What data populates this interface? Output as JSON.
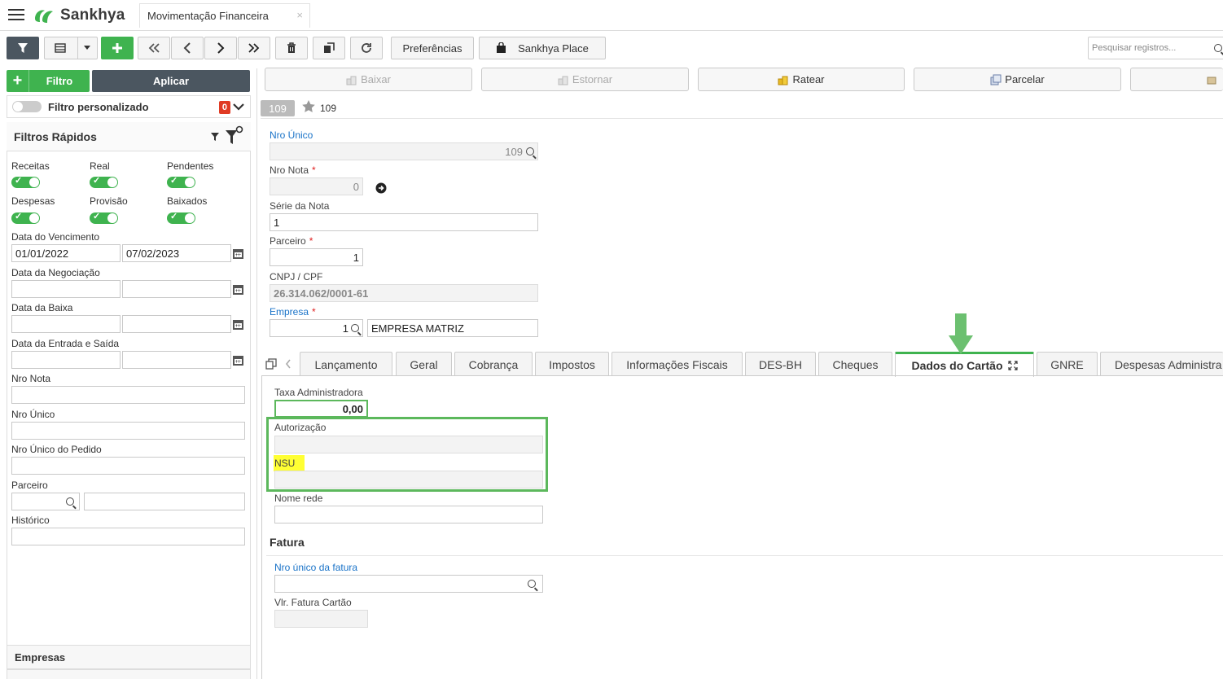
{
  "app": {
    "brand": "Sankhya",
    "tab_title": "Movimentação Financeira",
    "tab_close": "×"
  },
  "toolbar": {
    "preferences_label": "Preferências",
    "place_label": "Sankhya Place",
    "search_placeholder": "Pesquisar registros..."
  },
  "filter_panel": {
    "filter_button": "Filtro",
    "apply_button": "Aplicar",
    "custom_filter_label": "Filtro personalizado",
    "custom_filter_count": "0",
    "quick_filters_title": "Filtros Rápidos",
    "toggles": [
      {
        "label": "Receitas",
        "on": true
      },
      {
        "label": "Real",
        "on": true
      },
      {
        "label": "Pendentes",
        "on": true
      },
      {
        "label": "Despesas",
        "on": true
      },
      {
        "label": "Provisão",
        "on": true
      },
      {
        "label": "Baixados",
        "on": true
      }
    ],
    "data_vencimento_label": "Data do Vencimento",
    "data_vencimento_de": "01/01/2022",
    "data_vencimento_ate": "07/02/2023",
    "data_negociacao_label": "Data da Negociação",
    "data_baixa_label": "Data da Baixa",
    "data_entrada_saida_label": "Data da Entrada e Saída",
    "nro_nota_label": "Nro Nota",
    "nro_unico_label": "Nro Único",
    "nro_unico_pedido_label": "Nro Único do Pedido",
    "parceiro_label": "Parceiro",
    "historico_label": "Histórico",
    "empresas_label": "Empresas"
  },
  "actions": {
    "baixar": "Baixar",
    "estornar": "Estornar",
    "ratear": "Ratear",
    "parcelar": "Parcelar"
  },
  "record": {
    "badge": "109",
    "number": "109",
    "nro_unico_label": "Nro Único",
    "nro_unico_value": "109",
    "nro_nota_label": "Nro Nota",
    "nro_nota_value": "0",
    "serie_label": "Série da Nota",
    "serie_value": "1",
    "parceiro_label": "Parceiro",
    "parceiro_value": "1",
    "cnpj_label": "CNPJ / CPF",
    "cnpj_value": "26.314.062/0001-61",
    "empresa_label": "Empresa",
    "empresa_code": "1",
    "empresa_name": "EMPRESA MATRIZ",
    "required_mark": "*"
  },
  "tabs": [
    {
      "label": "Lançamento",
      "active": false
    },
    {
      "label": "Geral",
      "active": false
    },
    {
      "label": "Cobrança",
      "active": false
    },
    {
      "label": "Impostos",
      "active": false
    },
    {
      "label": "Informações Fiscais",
      "active": false
    },
    {
      "label": "DES-BH",
      "active": false
    },
    {
      "label": "Cheques",
      "active": false
    },
    {
      "label": "Dados do Cartão",
      "active": true
    },
    {
      "label": "GNRE",
      "active": false
    },
    {
      "label": "Despesas Administra",
      "active": false
    }
  ],
  "card_tab": {
    "taxa_label": "Taxa Administradora",
    "taxa_value": "0,00",
    "autorizacao_label": "Autorização",
    "nsu_label": "NSU",
    "nome_rede_label": "Nome rede",
    "fatura_title": "Fatura",
    "nro_unico_fatura_label": "Nro único da fatura",
    "vlr_fatura_label": "Vlr. Fatura Cartão"
  },
  "colors": {
    "accent_green": "#3fb34f",
    "dark_button": "#4b5660",
    "link_blue": "#1a73c8",
    "highlight_yellow": "#ffff33"
  }
}
